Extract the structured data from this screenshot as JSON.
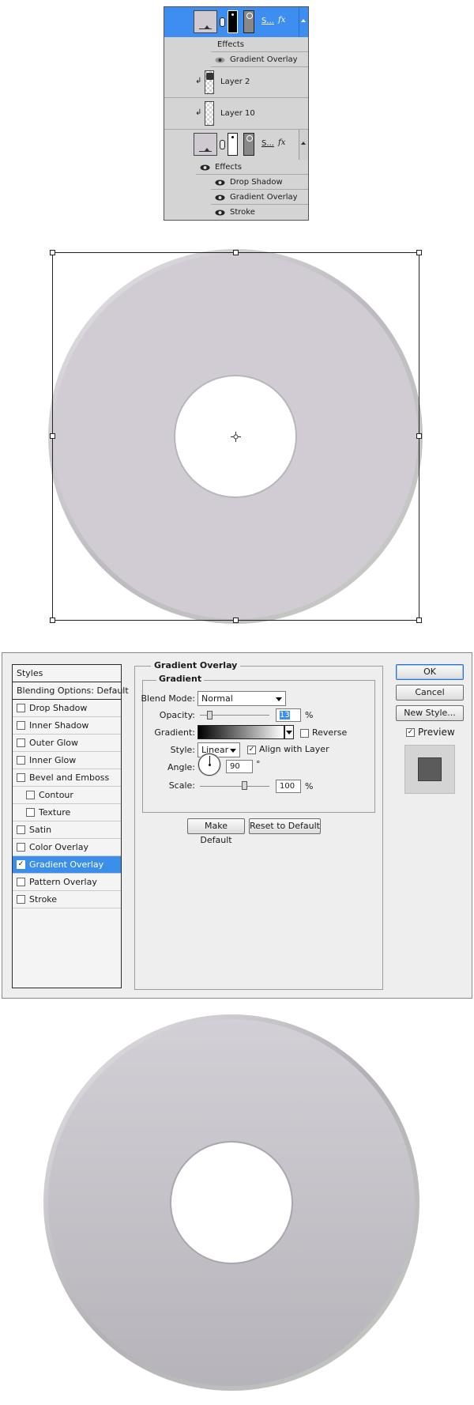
{
  "layers_panel": {
    "top_layer": {
      "name": "S...",
      "fx": "fx"
    },
    "top_effects": {
      "effects_label": "Effects",
      "items": [
        "Gradient Overlay"
      ]
    },
    "layers": [
      {
        "name": "Layer 2"
      },
      {
        "name": "Layer 10"
      }
    ],
    "bottom_layer": {
      "name": "S...",
      "fx": "fx"
    },
    "bottom_effects": {
      "effects_label": "Effects",
      "items": [
        "Drop Shadow",
        "Gradient Overlay",
        "Stroke"
      ]
    },
    "icons": {
      "eye": "eye-icon",
      "clip": "clip-arrow-icon",
      "link": "chain-link-icon",
      "scroll": "scroll-up-icon"
    },
    "colors": {
      "selected_row": "#3d8ef0",
      "panel_bg": "#d4d4d4"
    }
  },
  "dialog": {
    "styles_header": "Styles",
    "blending_options": "Blending Options: Default",
    "style_items": [
      {
        "label": "Drop Shadow",
        "checked": false,
        "indent": false
      },
      {
        "label": "Inner Shadow",
        "checked": false,
        "indent": false
      },
      {
        "label": "Outer Glow",
        "checked": false,
        "indent": false
      },
      {
        "label": "Inner Glow",
        "checked": false,
        "indent": false
      },
      {
        "label": "Bevel and Emboss",
        "checked": false,
        "indent": false
      },
      {
        "label": "Contour",
        "checked": false,
        "indent": true
      },
      {
        "label": "Texture",
        "checked": false,
        "indent": true
      },
      {
        "label": "Satin",
        "checked": false,
        "indent": false
      },
      {
        "label": "Color Overlay",
        "checked": false,
        "indent": false
      },
      {
        "label": "Gradient Overlay",
        "checked": true,
        "indent": false,
        "active": true
      },
      {
        "label": "Pattern Overlay",
        "checked": false,
        "indent": false
      },
      {
        "label": "Stroke",
        "checked": false,
        "indent": false
      }
    ],
    "gradient_overlay": {
      "title": "Gradient Overlay",
      "subtitle": "Gradient",
      "blend_mode_label": "Blend Mode:",
      "blend_mode_value": "Normal",
      "opacity_label": "Opacity:",
      "opacity_value": "13",
      "opacity_unit": "%",
      "gradient_label": "Gradient:",
      "reverse_label": "Reverse",
      "reverse_checked": false,
      "style_label": "Style:",
      "style_value": "Linear",
      "align_label": "Align with Layer",
      "align_checked": true,
      "angle_label": "Angle:",
      "angle_value": "90",
      "angle_unit": "°",
      "scale_label": "Scale:",
      "scale_value": "100",
      "scale_unit": "%",
      "make_default": "Make Default",
      "reset_default": "Reset to Default"
    },
    "buttons": {
      "ok": "OK",
      "cancel": "Cancel",
      "new_style": "New Style...",
      "preview": "Preview"
    },
    "preview_checked": true,
    "colors": {
      "active_item": "#3b8eea",
      "dialog_bg": "#eeeeee"
    }
  },
  "canvas": {
    "ring_color": "#d1ccd4",
    "rim_color": "#b9b6ba",
    "ring_gradient_top": "#d3cfd6",
    "ring_gradient_bottom": "#b6b3ba"
  }
}
